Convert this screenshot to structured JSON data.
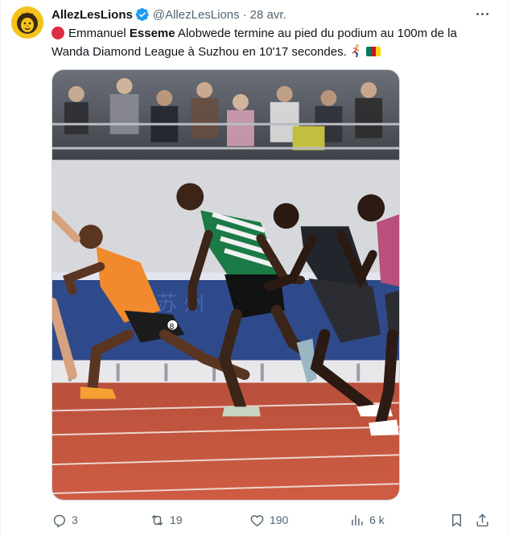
{
  "author": {
    "display_name": "AllezLesLions",
    "handle": "@AllezLesLions",
    "separator": "·",
    "date": "28 avr.",
    "avatar_icon": "lion-logo",
    "verified_icon": "verified-badge-icon",
    "verified_color": "#1d9bf0"
  },
  "tweet": {
    "text_before_bold": "Emmanuel ",
    "bold_name": "Esseme",
    "text_after_bold": " Alobwede termine au pied du podium au 100m de la Wanda Diamond League à Suzhou en 10'17 secondes.",
    "emojis": [
      "red-circle",
      "runner",
      "flag-cameroon"
    ]
  },
  "media": {
    "alt_subject": "100m sprint finish photo",
    "bib_numbers": [
      "8"
    ]
  },
  "actions": {
    "reply_count": "3",
    "retweet_count": "19",
    "like_count": "190",
    "views_count": "6 k"
  },
  "colors": {
    "text_primary": "#0f1419",
    "text_secondary": "#536471",
    "accent": "#1d9bf0",
    "track": "#c4523a"
  }
}
